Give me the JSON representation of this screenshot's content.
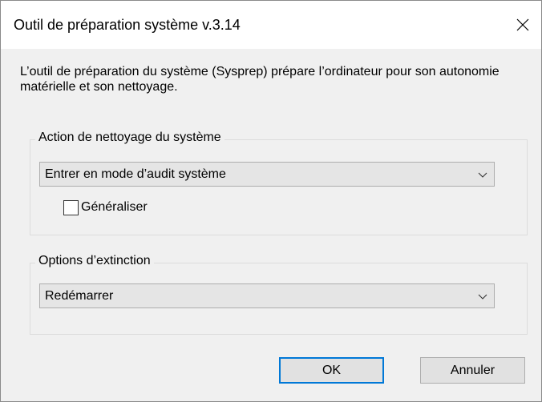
{
  "window": {
    "title": "Outil de préparation système v.3.14"
  },
  "description": "L’outil de préparation du système (Sysprep) prépare l’ordinateur pour son autonomie matérielle et son nettoyage.",
  "cleanup_group": {
    "legend": "Action de nettoyage du système",
    "selected_action": "Entrer en mode d’audit système",
    "generalize_label": "Généraliser",
    "generalize_checked": false
  },
  "shutdown_group": {
    "legend": "Options d’extinction",
    "selected_option": "Redémarrer"
  },
  "buttons": {
    "ok": "OK",
    "cancel": "Annuler"
  },
  "colors": {
    "titlebar_bg": "#ffffff",
    "dialog_bg": "#f0f0f0",
    "default_button_border": "#0078d7"
  },
  "icons": {
    "close": "close-icon",
    "dropdown": "chevron-down-icon"
  }
}
